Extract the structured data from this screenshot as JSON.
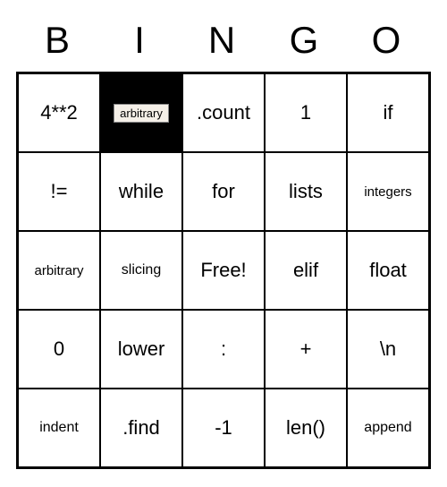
{
  "header": [
    "B",
    "I",
    "N",
    "G",
    "O"
  ],
  "grid": [
    [
      {
        "text": "4**2",
        "selected": false,
        "size": "normal"
      },
      {
        "text": "arbitrary",
        "selected": true,
        "size": "normal"
      },
      {
        "text": ".count",
        "selected": false,
        "size": "normal"
      },
      {
        "text": "1",
        "selected": false,
        "size": "normal"
      },
      {
        "text": "if",
        "selected": false,
        "size": "normal"
      }
    ],
    [
      {
        "text": "!=",
        "selected": false,
        "size": "normal"
      },
      {
        "text": "while",
        "selected": false,
        "size": "normal"
      },
      {
        "text": "for",
        "selected": false,
        "size": "normal"
      },
      {
        "text": "lists",
        "selected": false,
        "size": "normal"
      },
      {
        "text": "integers",
        "selected": false,
        "size": "xsmall"
      }
    ],
    [
      {
        "text": "arbitrary",
        "selected": false,
        "size": "xsmall"
      },
      {
        "text": "slicing",
        "selected": false,
        "size": "small"
      },
      {
        "text": "Free!",
        "selected": false,
        "size": "normal"
      },
      {
        "text": "elif",
        "selected": false,
        "size": "normal"
      },
      {
        "text": "float",
        "selected": false,
        "size": "normal"
      }
    ],
    [
      {
        "text": "0",
        "selected": false,
        "size": "normal"
      },
      {
        "text": "lower",
        "selected": false,
        "size": "normal"
      },
      {
        "text": ":",
        "selected": false,
        "size": "normal"
      },
      {
        "text": "+",
        "selected": false,
        "size": "normal"
      },
      {
        "text": "\\n",
        "selected": false,
        "size": "normal"
      }
    ],
    [
      {
        "text": "indent",
        "selected": false,
        "size": "small"
      },
      {
        "text": ".find",
        "selected": false,
        "size": "normal"
      },
      {
        "text": "-1",
        "selected": false,
        "size": "normal"
      },
      {
        "text": "len()",
        "selected": false,
        "size": "normal"
      },
      {
        "text": "append",
        "selected": false,
        "size": "small"
      }
    ]
  ]
}
